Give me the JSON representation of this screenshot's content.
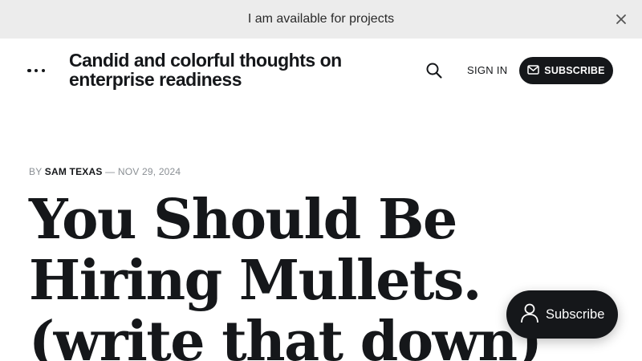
{
  "announcement": {
    "text": "I am available for projects",
    "close_icon": "close-icon"
  },
  "header": {
    "menu_icon": "more-dots-icon",
    "site_title": "Candid and colorful thoughts on enterprise readiness",
    "search_icon": "search-icon",
    "signin_label": "SIGN IN",
    "subscribe_label": "SUBSCRIBE",
    "subscribe_icon": "mail-icon"
  },
  "post": {
    "by_label": "BY",
    "author": "SAM TEXAS",
    "separator": "—",
    "date": "NOV 29, 2024",
    "title": "You Should Be Hiring Mullets. (write that down)"
  },
  "portal": {
    "label": "Subscribe",
    "icon": "user-icon"
  },
  "colors": {
    "brand_dark": "#15171a",
    "announcement_bg": "#ececec",
    "meta_gray": "#8a8f94"
  }
}
